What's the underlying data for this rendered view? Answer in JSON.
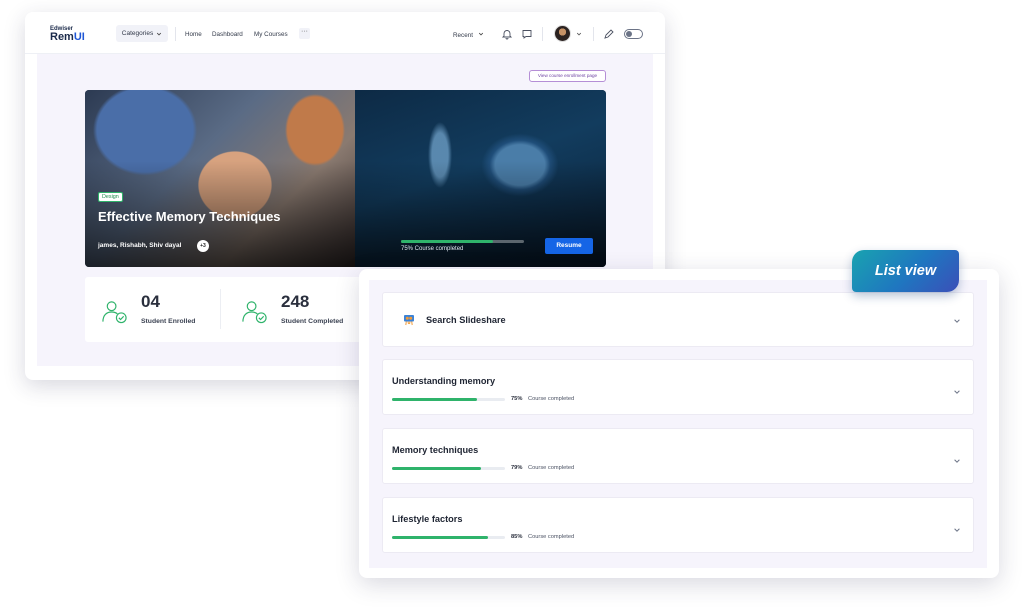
{
  "header": {
    "logo_small": "Edwiser",
    "logo_main": "Rem",
    "logo_accent": "UI",
    "categories_label": "Categories",
    "nav_links": [
      "Home",
      "Dashboard",
      "My Courses"
    ],
    "more_label": "···",
    "recent_label": "Recent"
  },
  "course": {
    "enrollment_button": "View course enrollment page",
    "tag": "Design",
    "title": "Effective Memory Techniques",
    "authors": "james, Rishabh, Shiv dayal",
    "extra_authors": "+3",
    "progress_text": "75% Course completed",
    "progress_value": 0.75,
    "resume_label": "Resume"
  },
  "stats": [
    {
      "value": "04",
      "label": "Student Enrolled"
    },
    {
      "value": "248",
      "label": "Student Completed"
    }
  ],
  "list_view": {
    "badge": "List view",
    "search_card": "Search Slideshare",
    "items": [
      {
        "title": "Understanding memory",
        "percent": "75%",
        "progress": 0.75,
        "status": "Course completed"
      },
      {
        "title": "Memory techniques",
        "percent": "79%",
        "progress": 0.79,
        "status": "Course completed"
      },
      {
        "title": "Lifestyle factors",
        "percent": "85%",
        "progress": 0.85,
        "status": "Course completed"
      }
    ]
  },
  "colors": {
    "brand_blue": "#1565e6",
    "progress_green": "#2fb36b",
    "panel_bg": "#f6f4fc"
  },
  "icons": [
    "chevron-down-icon",
    "bell-icon",
    "chat-icon",
    "avatar",
    "pen-icon",
    "theme-toggle",
    "user-check-icon",
    "slideshare-icon"
  ]
}
